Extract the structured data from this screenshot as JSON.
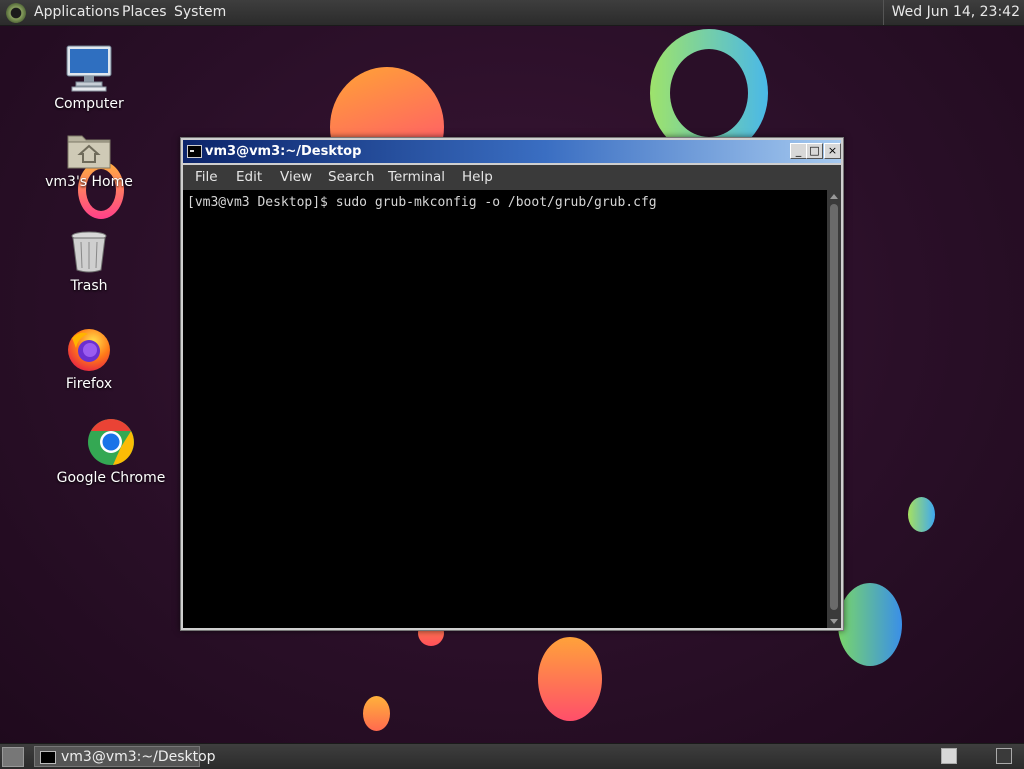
{
  "top_panel": {
    "menus": [
      "Applications",
      "Places",
      "System"
    ],
    "clock": "Wed Jun 14, 23:42"
  },
  "desktop": {
    "icons": [
      {
        "label": "Computer",
        "icon": "computer-icon"
      },
      {
        "label": "vm3's Home",
        "icon": "home-folder-icon"
      },
      {
        "label": "Trash",
        "icon": "trash-icon"
      },
      {
        "label": "Firefox",
        "icon": "firefox-icon"
      },
      {
        "label": "Google Chrome",
        "icon": "chrome-icon"
      }
    ]
  },
  "terminal": {
    "title": "vm3@vm3:~/Desktop",
    "window_buttons": [
      "_",
      "□",
      "×"
    ],
    "menu": [
      "File",
      "Edit",
      "View",
      "Search",
      "Terminal",
      "Help"
    ],
    "lines": [
      "[vm3@vm3 Desktop]$ sudo grub-mkconfig -o /boot/grub/grub.cfg"
    ]
  },
  "bottom_panel": {
    "task_label": "vm3@vm3:~/Desktop"
  },
  "colors": {
    "titlebar_start": "#0b246a",
    "titlebar_end": "#a6caf0",
    "terminal_bg": "#000000",
    "wallpaper": "#2a0f28"
  }
}
